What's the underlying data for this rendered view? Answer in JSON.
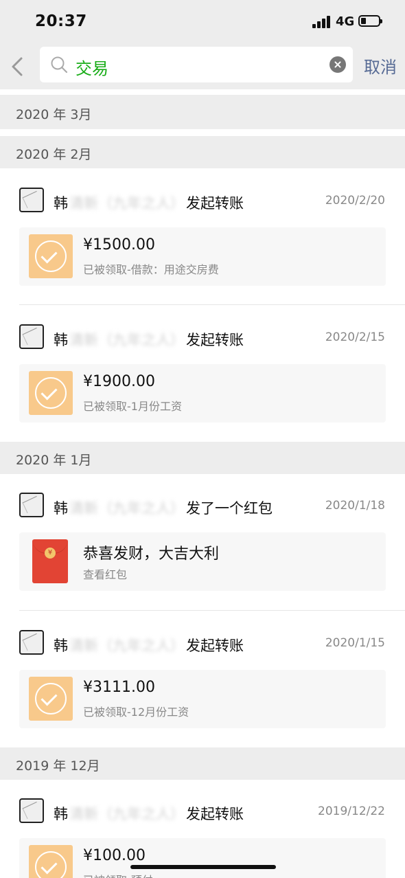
{
  "status": {
    "time": "20:37",
    "network": "4G"
  },
  "search": {
    "query": "交易",
    "cancel": "取消"
  },
  "sections": [
    {
      "label": "2020 年 3月"
    },
    {
      "label": "2020 年 2月"
    },
    {
      "label": "2020 年 1月"
    },
    {
      "label": "2019 年 12月"
    }
  ],
  "items": [
    {
      "name": "韩",
      "blurred": "清新（九年之人）",
      "action": "发起转账",
      "date": "2020/2/20",
      "amount": "¥1500.00",
      "sub": "已被领取-借款：用途交房费"
    },
    {
      "name": "韩",
      "blurred": "清新（九年之人）",
      "action": "发起转账",
      "date": "2020/2/15",
      "amount": "¥1900.00",
      "sub": "已被领取-1月份工资"
    },
    {
      "name": "韩",
      "blurred": "清新（九年之人）",
      "action": "发了一个红包",
      "date": "2020/1/18",
      "amount": "恭喜发财，大吉大利",
      "sub": "查看红包"
    },
    {
      "name": "韩",
      "blurred": "清新（九年之人）",
      "action": "发起转账",
      "date": "2020/1/15",
      "amount": "¥3111.00",
      "sub": "已被领取-12月份工资"
    },
    {
      "name": "韩",
      "blurred": "清新（九年之人）",
      "action": "发起转账",
      "date": "2019/12/22",
      "amount": "¥100.00",
      "sub": "已被领取-预付"
    }
  ],
  "colors": {
    "accent_green": "#1aad19",
    "link_blue": "#576b95",
    "transfer_orange": "#f8c98b",
    "redpacket_red": "#e24434"
  }
}
